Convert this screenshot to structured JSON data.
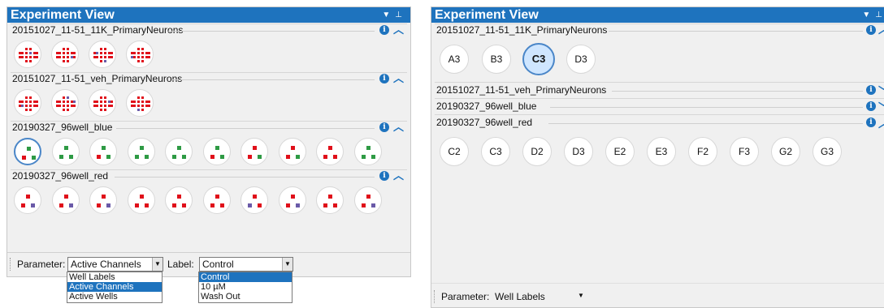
{
  "left_panel": {
    "title": "Experiment View",
    "groups": [
      {
        "name": "20151027_11-51_11K_PrimaryNeurons",
        "expanded": true
      },
      {
        "name": "20151027_11-51_veh_PrimaryNeurons",
        "expanded": true
      },
      {
        "name": "20190327_96well_blue",
        "expanded": true
      },
      {
        "name": "20190327_96well_red",
        "expanded": true
      }
    ],
    "parameter_label": "Parameter:",
    "parameter_value": "Active Channels",
    "label_label": "Label:",
    "label_value": "Control",
    "parameter_options": [
      "Well Labels",
      "Active Channels",
      "Active Wells"
    ],
    "parameter_selected": "Active Channels",
    "label_options": [
      "Control",
      "10 µM",
      "Wash Out"
    ],
    "label_selected": "Control"
  },
  "right_panel": {
    "title": "Experiment View",
    "groups": [
      {
        "name": "20151027_11-51_11K_PrimaryNeurons",
        "expanded": true,
        "wells": [
          "A3",
          "B3",
          "C3",
          "D3"
        ],
        "selected": "C3"
      },
      {
        "name": "20151027_11-51_veh_PrimaryNeurons",
        "expanded": false,
        "wells": []
      },
      {
        "name": "20190327_96well_blue",
        "expanded": false,
        "wells": []
      },
      {
        "name": "20190327_96well_red",
        "expanded": true,
        "wells": [
          "C2",
          "C3",
          "D2",
          "D3",
          "E2",
          "E3",
          "F2",
          "F3",
          "G2",
          "G3"
        ]
      }
    ],
    "parameter_label": "Parameter:",
    "parameter_value": "Well Labels"
  },
  "icons": {
    "info": "info-icon",
    "collapse": "chevron-up-icon",
    "expand": "chevron-down-icon",
    "pin": "pin-icon",
    "menu": "dropdown-arrow-icon"
  },
  "colors": {
    "title_bar": "#1e73be",
    "active": "#e0101a",
    "inactive": "#6a5aa8",
    "green": "#2e9a44",
    "selection": "#1e73be"
  }
}
